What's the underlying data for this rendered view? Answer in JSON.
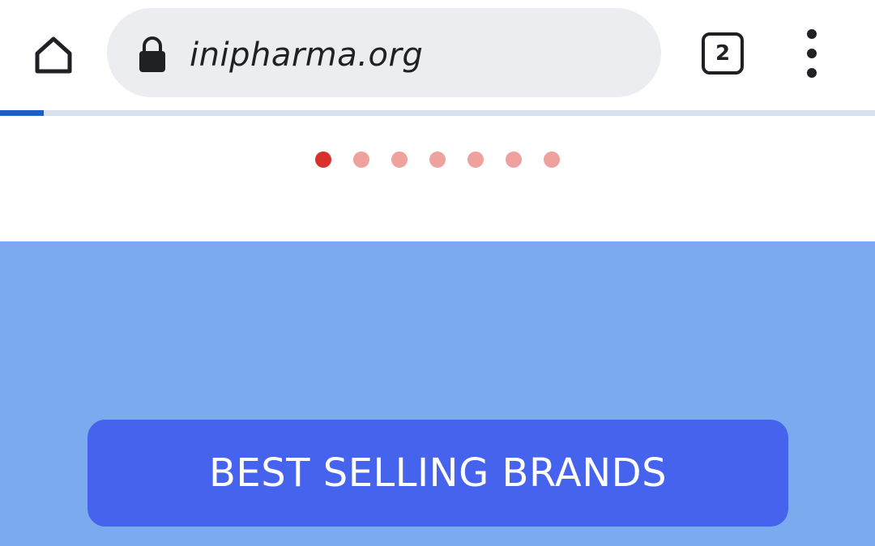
{
  "browser": {
    "url": "inipharma.org",
    "tab_count": "2",
    "icons": {
      "home": "home-icon",
      "lock": "lock-icon",
      "menu": "more-vert-icon"
    },
    "page_load_progress": 0.05
  },
  "carousel": {
    "dot_count": 7,
    "active_index": 0,
    "active_color": "#d9302a",
    "inactive_color": "#eea19d"
  },
  "section": {
    "background_color": "#7baaee",
    "button_label": "BEST SELLING BRANDS",
    "button_color": "#4563ed"
  }
}
